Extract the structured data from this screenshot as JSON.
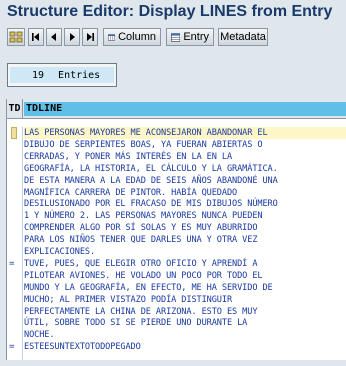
{
  "window": {
    "title": "Structure Editor: Display LINES from Entry"
  },
  "toolbar": {
    "column_label": "Column",
    "entry_label": "Entry",
    "metadata_label": "Metadata"
  },
  "entries": {
    "count": "19",
    "label": "Entries"
  },
  "table": {
    "col_td": "TD",
    "col_tdline": "TDLINE",
    "rows": [
      {
        "td": "",
        "text": "LAS PERSONAS MAYORES ME ACONSEJARON ABANDONAR EL",
        "selected": true
      },
      {
        "td": "",
        "text": "DIBUJO DE SERPIENTES BOAS, YA FUERAN ABIERTAS O"
      },
      {
        "td": "",
        "text": "CERRADAS, Y PONER MÁS INTERÉS EN LA EN LA"
      },
      {
        "td": "",
        "text": "GEOGRAFÍA, LA HISTORIA, EL CÁLCULO Y LA GRAMÁTICA."
      },
      {
        "td": "",
        "text": "DE ESTA MANERA A LA EDAD DE SEIS AÑOS ABANDONÉ UNA"
      },
      {
        "td": "",
        "text": "MAGNÍFICA CARRERA DE PINTOR. HABÍA QUEDADO"
      },
      {
        "td": "",
        "text": "DESILUSIONADO POR EL FRACASO DE MIS DIBUJOS NÚMERO"
      },
      {
        "td": "",
        "text": "1 Y NÚMERO 2. LAS PERSONAS MAYORES NUNCA PUEDEN"
      },
      {
        "td": "",
        "text": "COMPRENDER ALGO POR SÍ SOLAS Y ES MUY ABURRIDO"
      },
      {
        "td": "",
        "text": "PARA LOS NIÑOS TENER QUE DARLES UNA Y OTRA VEZ"
      },
      {
        "td": "",
        "text": "EXPLICACIONES."
      },
      {
        "td": "=",
        "text": "TUVE, PUES, QUE ELEGIR OTRO OFICIO Y APRENDÍ A"
      },
      {
        "td": "",
        "text": "PILOTEAR AVIONES. HE VOLADO UN POCO POR TODO EL"
      },
      {
        "td": "",
        "text": "MUNDO Y LA GEOGRAFÍA, EN EFECTO, ME HA SERVIDO DE"
      },
      {
        "td": "",
        "text": "MUCHO; AL PRIMER VISTAZO PODÍA DISTINGUIR"
      },
      {
        "td": "",
        "text": "PERFECTAMENTE LA CHINA DE ARIZONA. ESTO ES MUY"
      },
      {
        "td": "",
        "text": "ÚTIL, SOBRE TODO SI SE PIERDE UNO DURANTE LA"
      },
      {
        "td": "",
        "text": "NOCHE."
      },
      {
        "td": "=",
        "text": "ESTEESUNTEXTOTODOPEGADO"
      }
    ]
  }
}
